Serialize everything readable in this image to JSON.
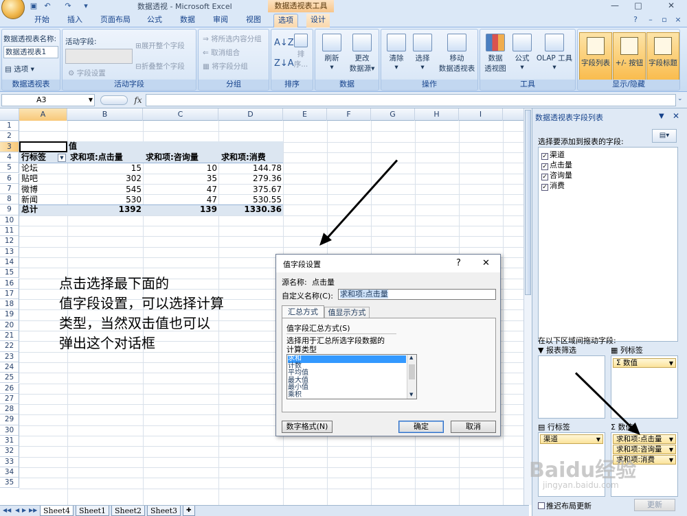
{
  "window": {
    "title": "数据透视 - Microsoft Excel",
    "context_tab_title": "数据透视表工具",
    "min": "—",
    "max": "□",
    "close": "✕"
  },
  "tabs": [
    "开始",
    "插入",
    "页面布局",
    "公式",
    "数据",
    "审阅",
    "视图",
    "选项",
    "设计"
  ],
  "active_tab": "选项",
  "ribbon": {
    "pivot": {
      "name_label": "数据透视表名称:",
      "name_value": "数据透视表1",
      "options": "选项",
      "group": "数据透视表"
    },
    "active_field": {
      "label": "活动字段:",
      "expand": "展开整个字段",
      "collapse": "折叠整个字段",
      "settings": "字段设置",
      "group": "活动字段"
    },
    "grouping": {
      "group_sel": "将所选内容分组",
      "ungroup": "取消组合",
      "group_field": "将字段分组",
      "group": "分组"
    },
    "sort": {
      "sort": "排序...",
      "group": "排序"
    },
    "data": {
      "refresh": "刷新",
      "change_l1": "更改",
      "change_l2": "数据源",
      "group": "数据"
    },
    "actions": {
      "clear": "清除",
      "select": "选择",
      "move_l1": "移动",
      "move_l2": "数据透视表",
      "group": "操作"
    },
    "tools": {
      "chart_l1": "数据",
      "chart_l2": "透视图",
      "formula": "公式",
      "olap": "OLAP 工具",
      "group": "工具"
    },
    "show": {
      "field_list": "字段列表",
      "buttons": "+/- 按钮",
      "headers": "字段标题",
      "group": "显示/隐藏"
    }
  },
  "formula_bar": {
    "name_box": "A3",
    "fx": "fx"
  },
  "columns": [
    "A",
    "B",
    "C",
    "D",
    "E",
    "F",
    "G",
    "H",
    "I"
  ],
  "rows": [
    "1",
    "2",
    "3",
    "4",
    "5",
    "6",
    "7",
    "8",
    "9",
    "10",
    "11",
    "12",
    "13",
    "14",
    "15",
    "16",
    "17",
    "18",
    "19",
    "20",
    "21",
    "22",
    "23",
    "24",
    "25",
    "26",
    "27",
    "28",
    "29",
    "30",
    "31",
    "32",
    "33",
    "34",
    "35"
  ],
  "pivot_table": {
    "values_header": "值",
    "row_label_header": "行标签",
    "headers": [
      "求和项:点击量",
      "求和项:咨询量",
      "求和项:消费"
    ],
    "rows": [
      {
        "label": "论坛",
        "values": [
          "15",
          "10",
          "144.78"
        ]
      },
      {
        "label": "贴吧",
        "values": [
          "302",
          "35",
          "279.36"
        ]
      },
      {
        "label": "微博",
        "values": [
          "545",
          "47",
          "375.67"
        ]
      },
      {
        "label": "新闻",
        "values": [
          "530",
          "47",
          "530.55"
        ]
      }
    ],
    "total": {
      "label": "总计",
      "values": [
        "1392",
        "139",
        "1330.36"
      ]
    }
  },
  "annotation_lines": [
    "点击选择最下面的",
    "值字段设置，可以选择计算",
    "类型，当然双击值也可以",
    "弹出这个对话框"
  ],
  "sheet_tabs": [
    "Sheet4",
    "Sheet1",
    "Sheet2",
    "Sheet3"
  ],
  "field_list": {
    "title": "数据透视表字段列表",
    "prompt": "选择要添加到报表的字段:",
    "fields": [
      "渠道",
      "点击量",
      "咨询量",
      "消费"
    ],
    "drag_prompt": "在以下区域间拖动字段:",
    "report_filter": "报表筛选",
    "column_labels": "列标签",
    "row_labels": "行标签",
    "values": "数值",
    "column_items": [
      "数值"
    ],
    "row_items": [
      "渠道"
    ],
    "value_items": [
      "求和项:点击量",
      "求和项:咨询量",
      "求和项:消费"
    ],
    "defer": "推迟布局更新",
    "update": "更新"
  },
  "dialog": {
    "title": "值字段设置",
    "help": "?",
    "close": "✕",
    "source_label": "源名称:",
    "source_value": "点击量",
    "custom_label": "自定义名称(C):",
    "custom_value": "求和项:点击量",
    "tab_summary": "汇总方式",
    "tab_display": "值显示方式",
    "section": "值字段汇总方式(S)",
    "desc_l1": "选择用于汇总所选字段数据的",
    "desc_l2": "计算类型",
    "options": [
      "求和",
      "计数",
      "平均值",
      "最大值",
      "最小值",
      "乘积"
    ],
    "selected_option": "求和",
    "number_format": "数字格式(N)",
    "ok": "确定",
    "cancel": "取消"
  },
  "watermark": {
    "brand": "Baidu经验",
    "url": "jingyan.baidu.com"
  }
}
